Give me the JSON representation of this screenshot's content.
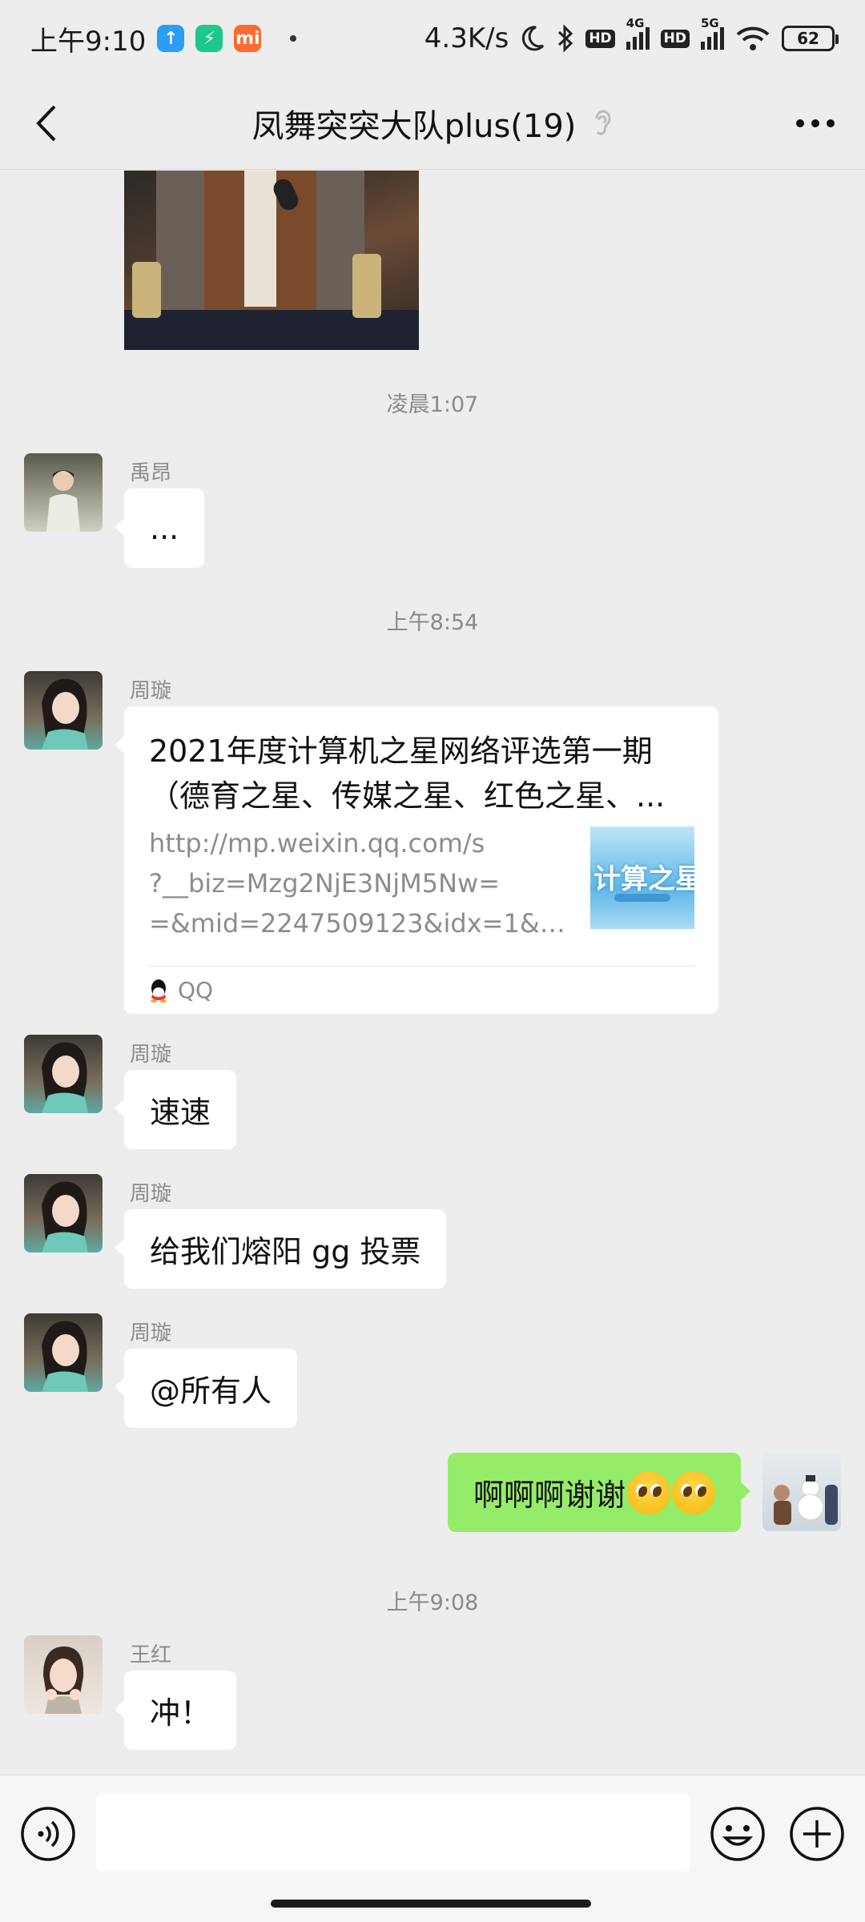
{
  "status_bar": {
    "time": "上午9:10",
    "network_speed": "4.3K/s",
    "signal_1": "4G",
    "signal_2": "5G",
    "hd_1": "HD",
    "hd_2": "HD",
    "battery": "62",
    "app_icons": [
      "upload-icon",
      "shield-icon",
      "mi-icon"
    ]
  },
  "header": {
    "title": "凤舞突突大队plus(19)",
    "back_icon": "chevron-left-icon",
    "earpiece_icon": "ear-icon",
    "more_icon": "more-icon"
  },
  "messages": [
    {
      "type": "image",
      "side": "left"
    },
    {
      "type": "time",
      "text": "凌晨1:07"
    },
    {
      "type": "text",
      "side": "left",
      "sender": "禹昂",
      "text": "..."
    },
    {
      "type": "time",
      "text": "上午8:54"
    },
    {
      "type": "link",
      "side": "left",
      "sender": "周璇",
      "title_line1": "2021年度计算机之星网络评选第一期",
      "title_line2": "（德育之星、传媒之星、红色之星、...",
      "url_line1": "http://mp.weixin.qq.com/s",
      "url_line2": "?__biz=Mzg2NjE3NjM5Nw=",
      "url_line3": "=&mid=2247509123&idx=1&sn...",
      "thumb_text": "计算之星",
      "source": "QQ"
    },
    {
      "type": "text",
      "side": "left",
      "sender": "周璇",
      "text": "速速"
    },
    {
      "type": "text",
      "side": "left",
      "sender": "周璇",
      "text": "给我们熔阳 gg 投票"
    },
    {
      "type": "text",
      "side": "left",
      "sender": "周璇",
      "text": "@所有人"
    },
    {
      "type": "text",
      "side": "right",
      "text": "啊啊啊谢谢",
      "emoji_count": 2
    },
    {
      "type": "time",
      "text": "上午9:08"
    },
    {
      "type": "text",
      "side": "left",
      "sender": "王红",
      "text": "冲！"
    }
  ],
  "input_bar": {
    "voice_icon": "voice-icon",
    "input_value": "",
    "emoji_icon": "emoji-icon",
    "plus_icon": "plus-icon"
  },
  "colors": {
    "background": "#ededed",
    "bubble_self": "#95ec69",
    "bubble_other": "#ffffff"
  }
}
